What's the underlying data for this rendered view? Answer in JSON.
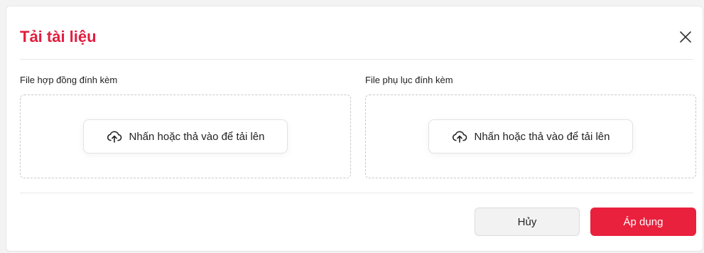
{
  "dialog": {
    "title": "Tải tài liệu",
    "title_color": "#e11d3f"
  },
  "icons": {
    "close": "close-icon",
    "upload": "cloud-upload-icon"
  },
  "contract_upload": {
    "label": "File hợp đồng đính kèm",
    "button_label": "Nhấn hoặc thả vào để tải lên"
  },
  "appendix_upload": {
    "label": "File phụ lục đính kèm",
    "button_label": "Nhấn hoặc thả vào để tải lên"
  },
  "footer": {
    "cancel_label": "Hủy",
    "apply_label": "Áp dụng",
    "apply_color": "#e9213d"
  }
}
